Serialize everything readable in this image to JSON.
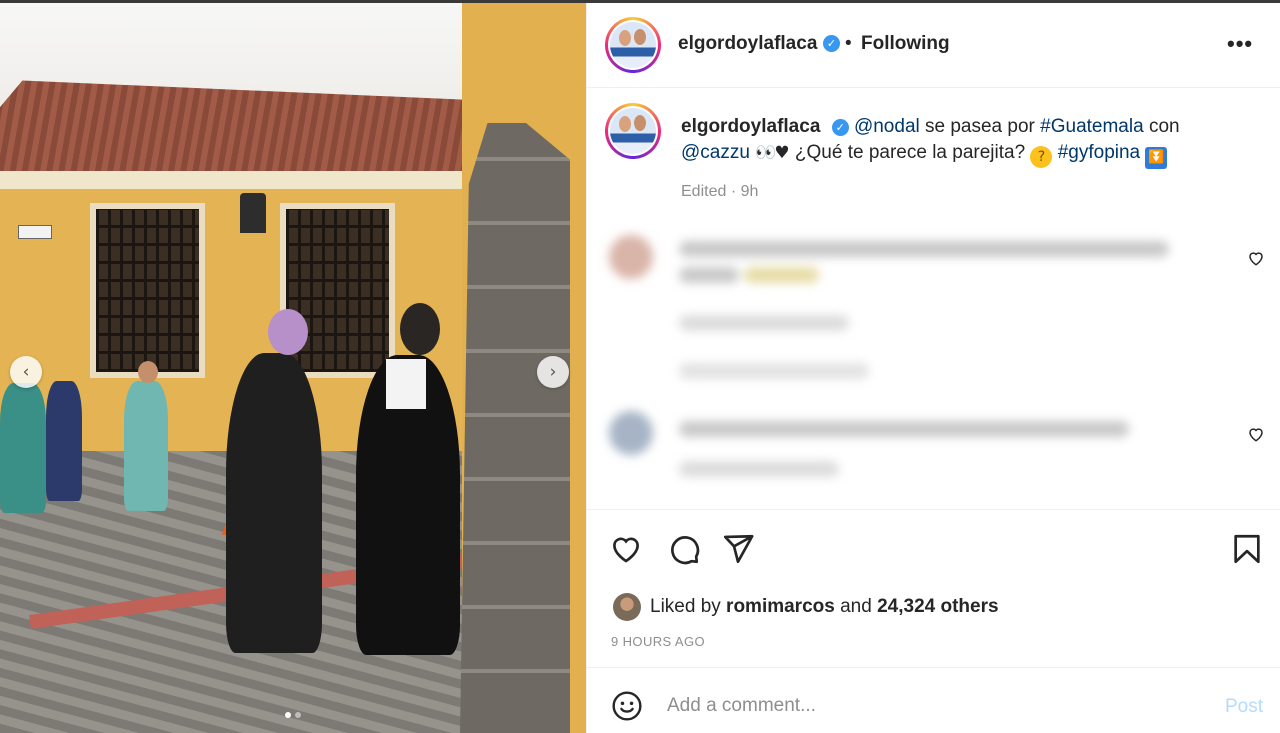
{
  "header": {
    "username": "elgordoylaflaca",
    "verified_glyph": "✓",
    "separator": "•",
    "follow_status": "Following",
    "more_label": "•••"
  },
  "caption": {
    "username": "elgordoylaflaca",
    "mention_1": "@nodal",
    "text_1": " se pasea por ",
    "hashtag_1": "#Guatemala",
    "text_2": " con ",
    "mention_2": "@cazzu",
    "emoji_eyes": "👀",
    "emoji_heart": "♥",
    "text_3": " ¿Qué te parece la parejita? ",
    "emoji_think": "?",
    "hashtag_2": "#gyfopina",
    "emoji_box": "⏬",
    "edited": "Edited · 9h"
  },
  "media": {
    "prev_label": "‹",
    "next_label": "›"
  },
  "likes": {
    "prefix": "Liked by ",
    "user": "romimarcos",
    "middle": " and ",
    "count": "24,324 others",
    "time": "9 HOURS AGO"
  },
  "comment_box": {
    "placeholder": "Add a comment...",
    "post_label": "Post"
  },
  "icons": [
    "heart-icon",
    "comment-icon",
    "share-icon",
    "bookmark-icon",
    "emoji-icon",
    "more-icon",
    "verified-icon"
  ],
  "colors": {
    "link": "#00376b",
    "verified": "#3897f0",
    "post_disabled": "#b3dbff",
    "muted": "#8e8e8e"
  }
}
